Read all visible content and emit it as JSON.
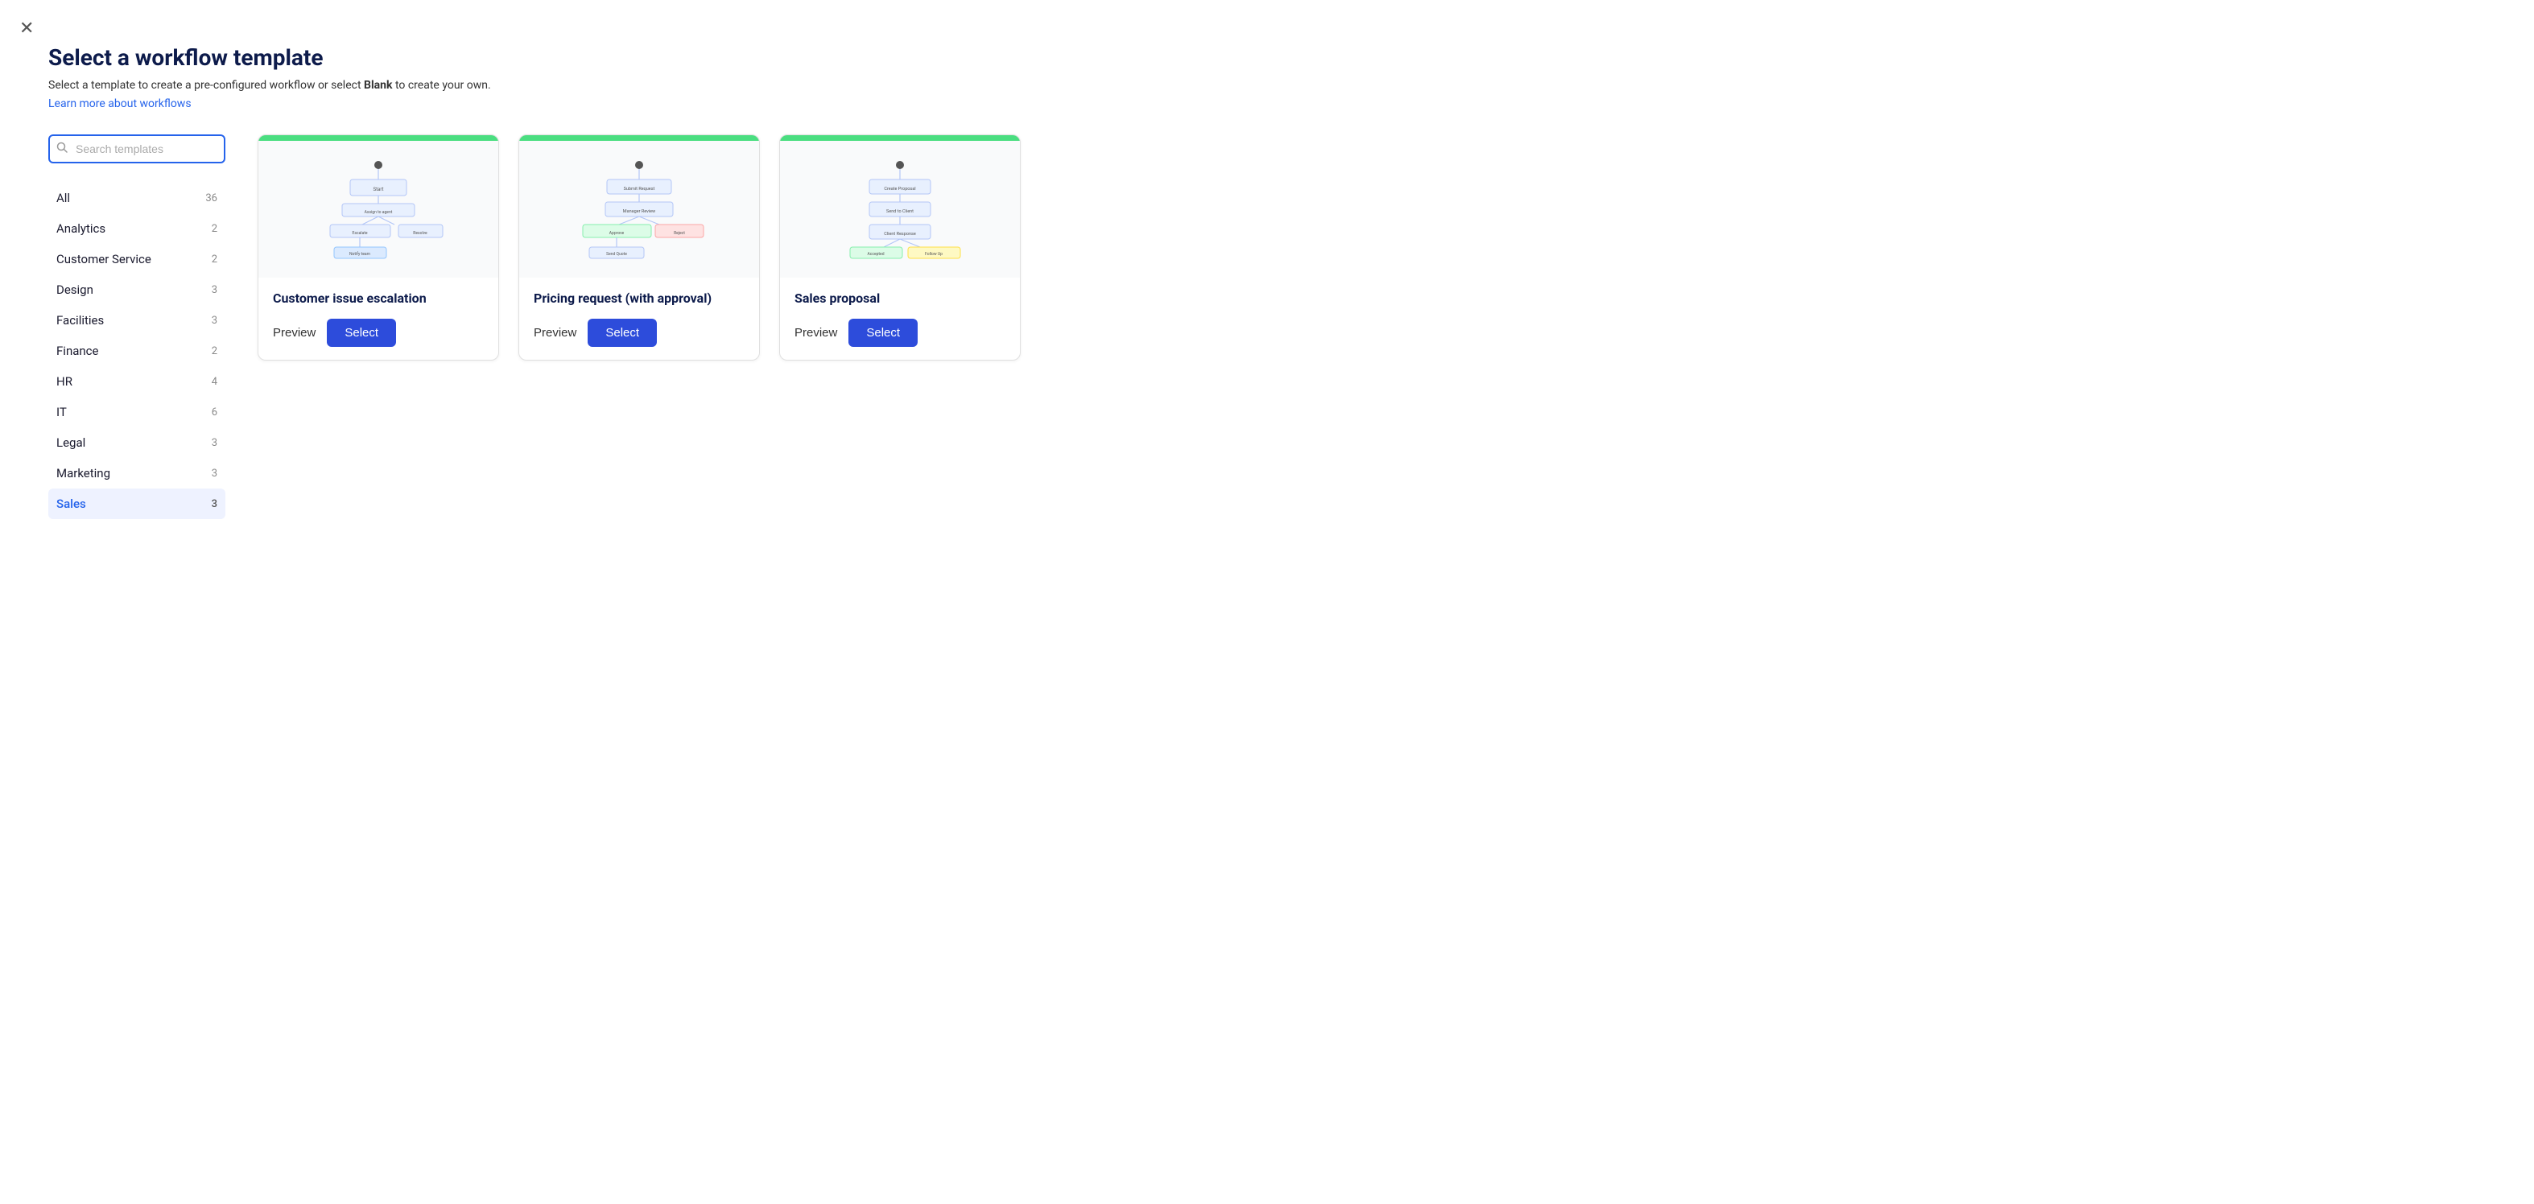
{
  "closeButton": "×",
  "header": {
    "title": "Select a workflow template",
    "subtitle": "Select a template to create a pre-configured workflow or select ",
    "subtitleBold": "Blank",
    "subtitleEnd": " to create your own.",
    "learnLink": "Learn more about workflows"
  },
  "search": {
    "placeholder": "Search templates"
  },
  "categories": [
    {
      "label": "All",
      "count": "36",
      "active": false
    },
    {
      "label": "Analytics",
      "count": "2",
      "active": false
    },
    {
      "label": "Customer Service",
      "count": "2",
      "active": false
    },
    {
      "label": "Design",
      "count": "3",
      "active": false
    },
    {
      "label": "Facilities",
      "count": "3",
      "active": false
    },
    {
      "label": "Finance",
      "count": "2",
      "active": false
    },
    {
      "label": "HR",
      "count": "4",
      "active": false
    },
    {
      "label": "IT",
      "count": "6",
      "active": false
    },
    {
      "label": "Legal",
      "count": "3",
      "active": false
    },
    {
      "label": "Marketing",
      "count": "3",
      "active": false
    },
    {
      "label": "Sales",
      "count": "3",
      "active": true
    }
  ],
  "templates": [
    {
      "title": "Customer issue escalation",
      "previewLabel": "Preview",
      "selectLabel": "Select"
    },
    {
      "title": "Pricing request (with approval)",
      "previewLabel": "Preview",
      "selectLabel": "Select"
    },
    {
      "title": "Sales proposal",
      "previewLabel": "Preview",
      "selectLabel": "Select"
    }
  ]
}
